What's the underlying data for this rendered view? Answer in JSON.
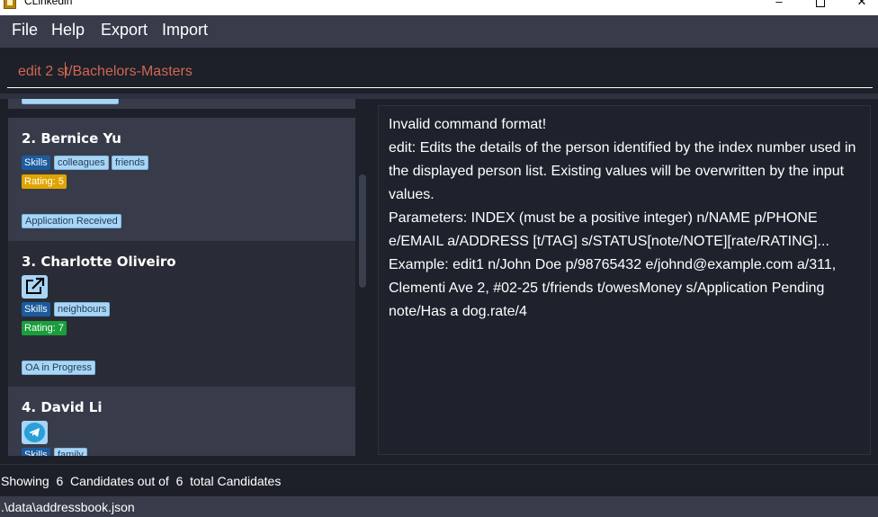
{
  "window": {
    "title": "CLinkedin",
    "minimize": "–",
    "close": "✕"
  },
  "menu": {
    "items": [
      "File",
      "Help",
      "Export",
      "Import"
    ]
  },
  "command": {
    "before_caret": "edit 2 s",
    "after_caret": "t/Bachelors-Masters"
  },
  "persons": [
    {
      "index_name": "2.  Bernice Yu",
      "skills_label": "Skills",
      "tags": [
        "colleagues",
        "friends"
      ],
      "rating": "Rating: 5",
      "status": "Application Received"
    },
    {
      "index_name": "3.  Charlotte Oliveiro",
      "link_icon": "external-link-icon",
      "skills_label": "Skills",
      "tags": [
        "neighbours"
      ],
      "rating": "Rating: 7",
      "status": "OA in Progress"
    },
    {
      "index_name": "4.  David Li",
      "link_icon": "telegram-icon",
      "skills_label": "Skills",
      "tags": [
        "family"
      ]
    }
  ],
  "result": {
    "text": "Invalid command format!\nedit: Edits the details of the person identified by the index number used in the displayed person list. Existing values will be overwritten by the input values.\nParameters: INDEX (must be a positive integer) n/NAME p/PHONE e/EMAIL a/ADDRESS [t/TAG] s/STATUS[note/NOTE][rate/RATING]...\nExample: edit1 n/John Doe p/98765432 e/johnd@example.com a/311, Clementi Ave 2, #02-25 t/friends t/owesMoney s/Application Pending note/Has a dog.rate/4"
  },
  "status": {
    "showing": "Showing  6  Candidates out of  6  total Candidates",
    "file_path": ".\\data\\addressbook.json"
  },
  "colors": {
    "background": "#1d2029",
    "panel": "#383c4a",
    "command_text": "#d06651",
    "skills_chip": "#1b5b9e",
    "tag_chip": "#a9d5f5",
    "rating_5": "#e0a400",
    "rating_7": "#1a9e3b"
  }
}
